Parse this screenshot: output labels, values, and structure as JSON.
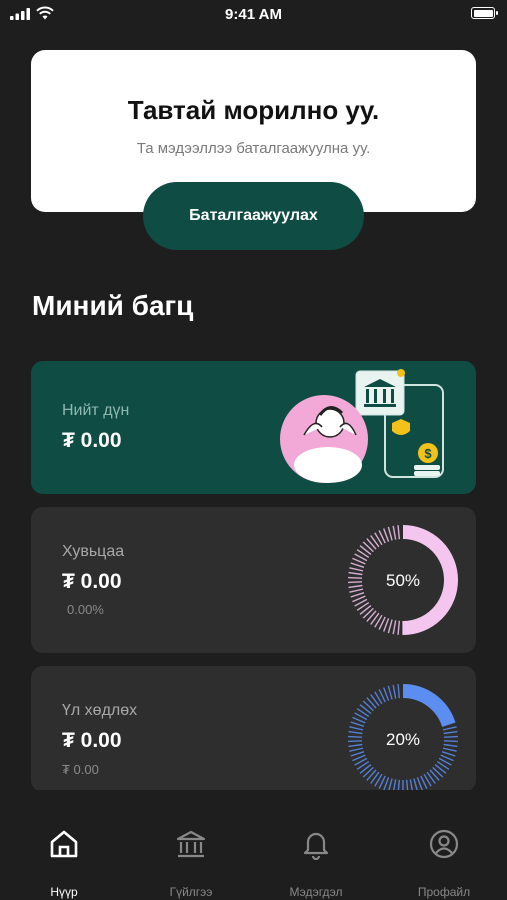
{
  "status_bar": {
    "time": "9:41 AM"
  },
  "welcome": {
    "title": "Тавтай морилно уу.",
    "subtitle": "Та мэдээллээ баталгаажуулна уу.",
    "verify_label": "Баталгаажуулах"
  },
  "section_title": "Миний багц",
  "cards": {
    "total": {
      "label": "Нийт дүн",
      "amount": "₮ 0.00"
    },
    "expense": {
      "label": "Хувьцаа",
      "amount": "₮ 0.00",
      "sub": "0.00%",
      "percent_label": "50%",
      "percent": 50,
      "color": "#f4c6ef"
    },
    "invest": {
      "label": "Үл хөдлөх",
      "amount": "₮ 0.00",
      "sub": "₮ 0.00",
      "percent_label": "20%",
      "percent": 20,
      "color": "#5b8ef0"
    }
  },
  "nav": {
    "items": [
      {
        "label": "Нүүр",
        "icon": "home-icon",
        "active": true
      },
      {
        "label": "Гүйлгээ",
        "icon": "bank-icon",
        "active": false
      },
      {
        "label": "Мэдэгдэл",
        "icon": "bell-icon",
        "active": false
      },
      {
        "label": "Профайл",
        "icon": "profile-icon",
        "active": false
      }
    ]
  },
  "colors": {
    "accent": "#0f4c44",
    "background": "#1e1e1e",
    "card": "#2e2e2e"
  }
}
